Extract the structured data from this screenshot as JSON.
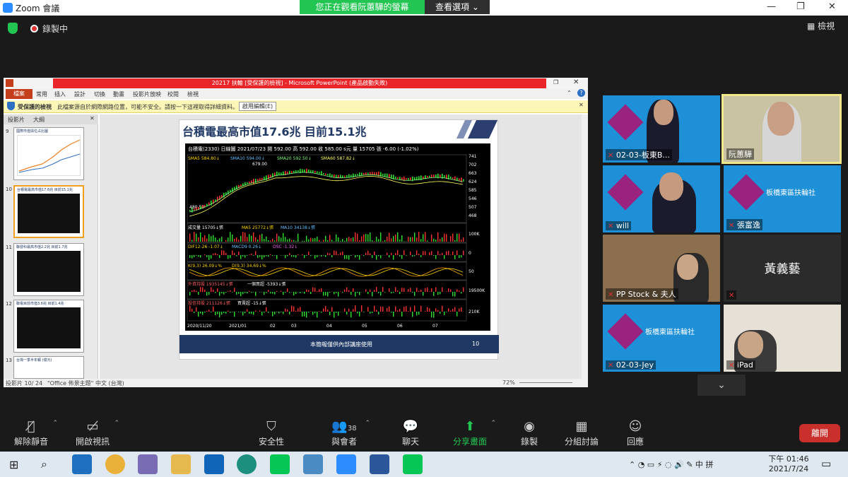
{
  "window": {
    "title": "Zoom 會議"
  },
  "banner": {
    "viewing": "您正在觀看阮蕙驊的螢幕",
    "view_options": "查看選項"
  },
  "recording": {
    "label": "錄製中"
  },
  "view_button": "檢視",
  "ppt": {
    "title": "20217 扶輪 [受保護的檢視] - Microsoft PowerPoint (產品啟動失敗)",
    "tabs": [
      "檔案",
      "常用",
      "插入",
      "設計",
      "切換",
      "動畫",
      "投影片放映",
      "校閱",
      "檢視"
    ],
    "protected_label": "受保護的檢視",
    "protected_msg": "此檔案源自於網際網路位置，可能不安全。請按一下這裡取得詳細資料。",
    "enable_edit": "啟用編輯(E)",
    "panel_tabs": [
      "投影片",
      "大綱"
    ],
    "thumb_numbers": [
      "9",
      "10",
      "11",
      "12",
      "13"
    ],
    "thumb_titles": [
      "國際市值與位占比圖",
      "台積電最高市值17.6兆 目前15.1兆",
      "聯發科最高市值2.2兆 目前1.7兆",
      "聯電目前市值3.6兆 目前1.4兆",
      "台灣一季半年報 (億元)"
    ],
    "slide_title": "台積電最高市值17.6兆 目前15.1兆",
    "slide_footer": "本簡報僅供內部講座使用",
    "slide_number": "10",
    "status_left": "投影片 10/ 24",
    "status_theme": "\"Office 佈景主題\"",
    "status_lang": "中文 (台灣)",
    "zoom": "72%"
  },
  "stock": {
    "header": "台積電(2330)    日線圖    2021/07/23  開 592.00  高 592.00  收 585.00 s元  量 15705 張  -6.00 (-1.02%)",
    "ma_line": [
      "SMA5 584.80↓",
      "SMA10 594.00↓",
      "SMA20 592.50↓",
      "SMA60 587.82↓"
    ],
    "high_label": "679.00",
    "low_label": "480.50",
    "y_ticks": [
      "741",
      "702",
      "663",
      "624",
      "585",
      "546",
      "507",
      "468"
    ],
    "vol_line": [
      "成交量 15705↓張",
      "MA5 25772↓張",
      "MA10 34138↓張"
    ],
    "vol_tick": "100K",
    "macd_line": [
      "DIF12-26 -1.07↓",
      "MACD9 0.26↓",
      "OSC -1.32↓"
    ],
    "macd_tick": "0",
    "kd_line": [
      "K(9,3) 26.09↓%",
      "D(9,3) 34.69↓%"
    ],
    "kd_tick": "50",
    "foreign_line": [
      "外資持股 1935145↓張",
      "一個買超 -5393↓張"
    ],
    "foreign_tick": "19500K",
    "trust_line": [
      "投信持股 211126↓張",
      "買賣超 -15↓張"
    ],
    "trust_tick": "210K",
    "x_labels": [
      "2020/11/20",
      "2021/01",
      "02",
      "03",
      "04",
      "05",
      "06",
      "07"
    ]
  },
  "participants": [
    {
      "name": "02-03-板東B...",
      "type": "person",
      "highlight": false
    },
    {
      "name": "阮蕙驊",
      "type": "person",
      "highlight": true
    },
    {
      "name": "will",
      "type": "person",
      "highlight": false
    },
    {
      "name": "張富逸",
      "type": "rotary",
      "highlight": false
    },
    {
      "name": "PP Stock & 夫人",
      "type": "person",
      "highlight": false
    },
    {
      "name": "黃義藝",
      "type": "text",
      "highlight": false
    },
    {
      "name": "02-03-Jey",
      "type": "rotary",
      "highlight": false
    },
    {
      "name": "iPad",
      "type": "person",
      "highlight": false
    }
  ],
  "rotary_text": "板橋東區扶輪社",
  "toolbar": {
    "mute": "解除靜音",
    "video": "開啟視訊",
    "security": "安全性",
    "participants": "與會者",
    "participants_count": "38",
    "chat": "聊天",
    "share": "分享畫面",
    "record": "錄製",
    "breakout": "分組討論",
    "reactions": "回應",
    "leave": "離開"
  },
  "clock": {
    "time": "下午 01:46",
    "date": "2021/7/24"
  }
}
